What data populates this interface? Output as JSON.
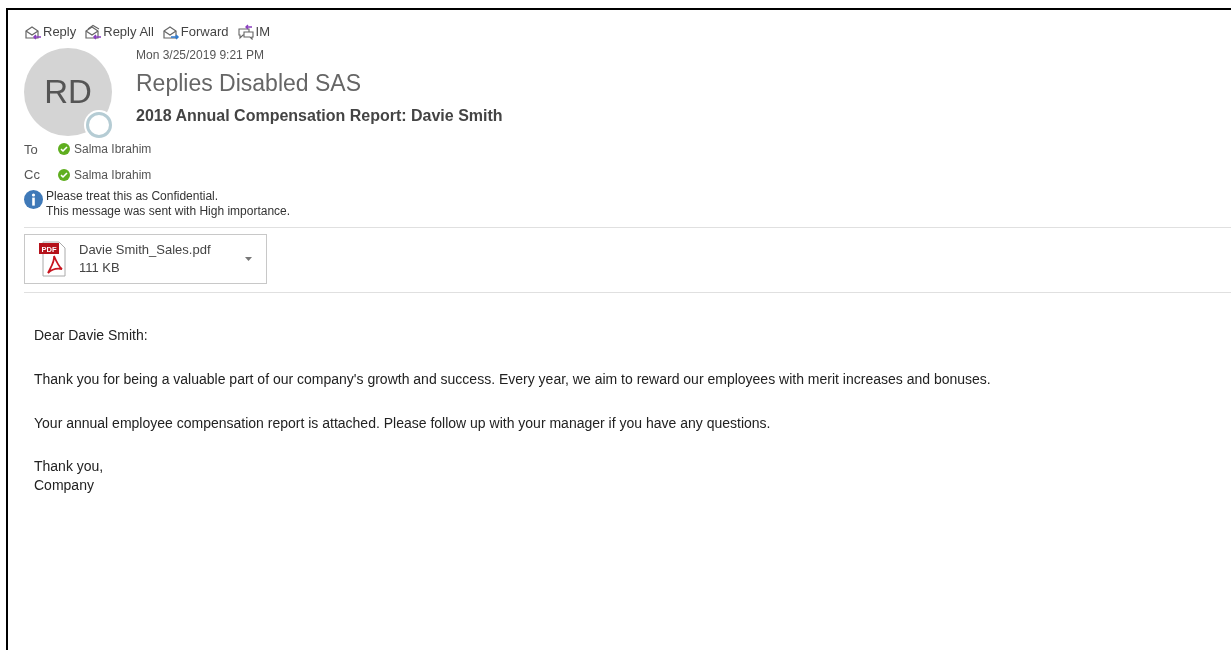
{
  "toolbar": [
    {
      "kind": "reply",
      "label": "Reply"
    },
    {
      "kind": "reply_all",
      "label": "Reply All"
    },
    {
      "kind": "forward",
      "label": "Forward"
    },
    {
      "kind": "im",
      "label": "IM"
    }
  ],
  "header": {
    "date": "Mon 3/25/2019 9:21 PM",
    "avatar_initials": "RD",
    "sender": "Replies Disabled SAS",
    "subject": "2018 Annual Compensation Report: Davie Smith"
  },
  "recipients": [
    {
      "label": "To",
      "name": "Salma Ibrahim"
    },
    {
      "label": "Cc",
      "name": "Salma Ibrahim"
    }
  ],
  "info": [
    "Please treat this as Confidential.",
    "This message was sent with High importance."
  ],
  "attachment": {
    "type_label": "PDF",
    "name": "Davie Smith_Sales.pdf",
    "size": "111 KB"
  },
  "body": [
    "Dear Davie Smith:",
    "Thank you for being a valuable part of our company's growth and success. Every year, we aim to reward our employees with merit increases and bonuses.",
    "Your annual employee compensation report is attached. Please follow up with your manager if you have any questions."
  ],
  "signature": [
    "Thank you,",
    "Company"
  ]
}
